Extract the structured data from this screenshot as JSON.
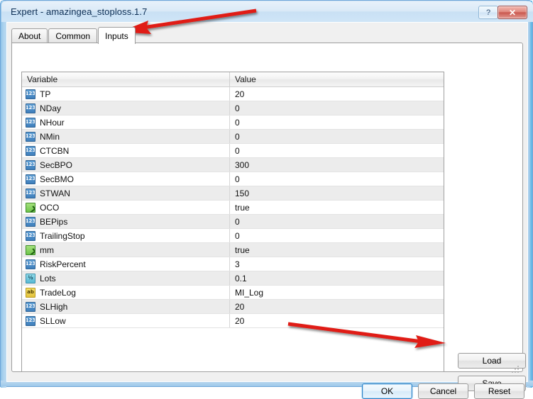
{
  "window": {
    "title": "Expert - amazingea_stoploss.1.7",
    "help_label": "?",
    "close_label": "✕",
    "accent_color": "#cfe3f4",
    "border_color": "#6ea6d9"
  },
  "tabs": [
    {
      "label": "About",
      "active": false
    },
    {
      "label": "Common",
      "active": false
    },
    {
      "label": "Inputs",
      "active": true
    }
  ],
  "grid": {
    "columns": [
      "Variable",
      "Value"
    ],
    "rows": [
      {
        "icon": "int-type-icon",
        "icon_glyph": "123",
        "variable": "TP",
        "value": "20"
      },
      {
        "icon": "int-type-icon",
        "icon_glyph": "123",
        "variable": "NDay",
        "value": "0"
      },
      {
        "icon": "int-type-icon",
        "icon_glyph": "123",
        "variable": "NHour",
        "value": "0"
      },
      {
        "icon": "int-type-icon",
        "icon_glyph": "123",
        "variable": "NMin",
        "value": "0"
      },
      {
        "icon": "int-type-icon",
        "icon_glyph": "123",
        "variable": "CTCBN",
        "value": "0"
      },
      {
        "icon": "int-type-icon",
        "icon_glyph": "123",
        "variable": "SecBPO",
        "value": "300"
      },
      {
        "icon": "int-type-icon",
        "icon_glyph": "123",
        "variable": "SecBMO",
        "value": "0"
      },
      {
        "icon": "int-type-icon",
        "icon_glyph": "123",
        "variable": "STWAN",
        "value": "150"
      },
      {
        "icon": "bool-type-icon",
        "icon_glyph": "",
        "variable": "OCO",
        "value": "true"
      },
      {
        "icon": "int-type-icon",
        "icon_glyph": "123",
        "variable": "BEPips",
        "value": "0"
      },
      {
        "icon": "int-type-icon",
        "icon_glyph": "123",
        "variable": "TrailingStop",
        "value": "0"
      },
      {
        "icon": "bool-type-icon",
        "icon_glyph": "",
        "variable": "mm",
        "value": "true"
      },
      {
        "icon": "int-type-icon",
        "icon_glyph": "123",
        "variable": "RiskPercent",
        "value": "3"
      },
      {
        "icon": "double-type-icon",
        "icon_glyph": "½",
        "variable": "Lots",
        "value": "0.1"
      },
      {
        "icon": "string-type-icon",
        "icon_glyph": "ab",
        "variable": "TradeLog",
        "value": "MI_Log"
      },
      {
        "icon": "int-type-icon",
        "icon_glyph": "123",
        "variable": "SLHigh",
        "value": "20"
      },
      {
        "icon": "int-type-icon",
        "icon_glyph": "123",
        "variable": "SLLow",
        "value": "20"
      }
    ]
  },
  "side_buttons": {
    "load_label": "Load",
    "save_label": "Save"
  },
  "dialog_buttons": {
    "ok_label": "OK",
    "cancel_label": "Cancel",
    "reset_label": "Reset"
  },
  "annotations": {
    "arrow_color": "#e01b12",
    "arrow_top_target": "Inputs tab",
    "arrow_bottom_target": "Save button"
  }
}
